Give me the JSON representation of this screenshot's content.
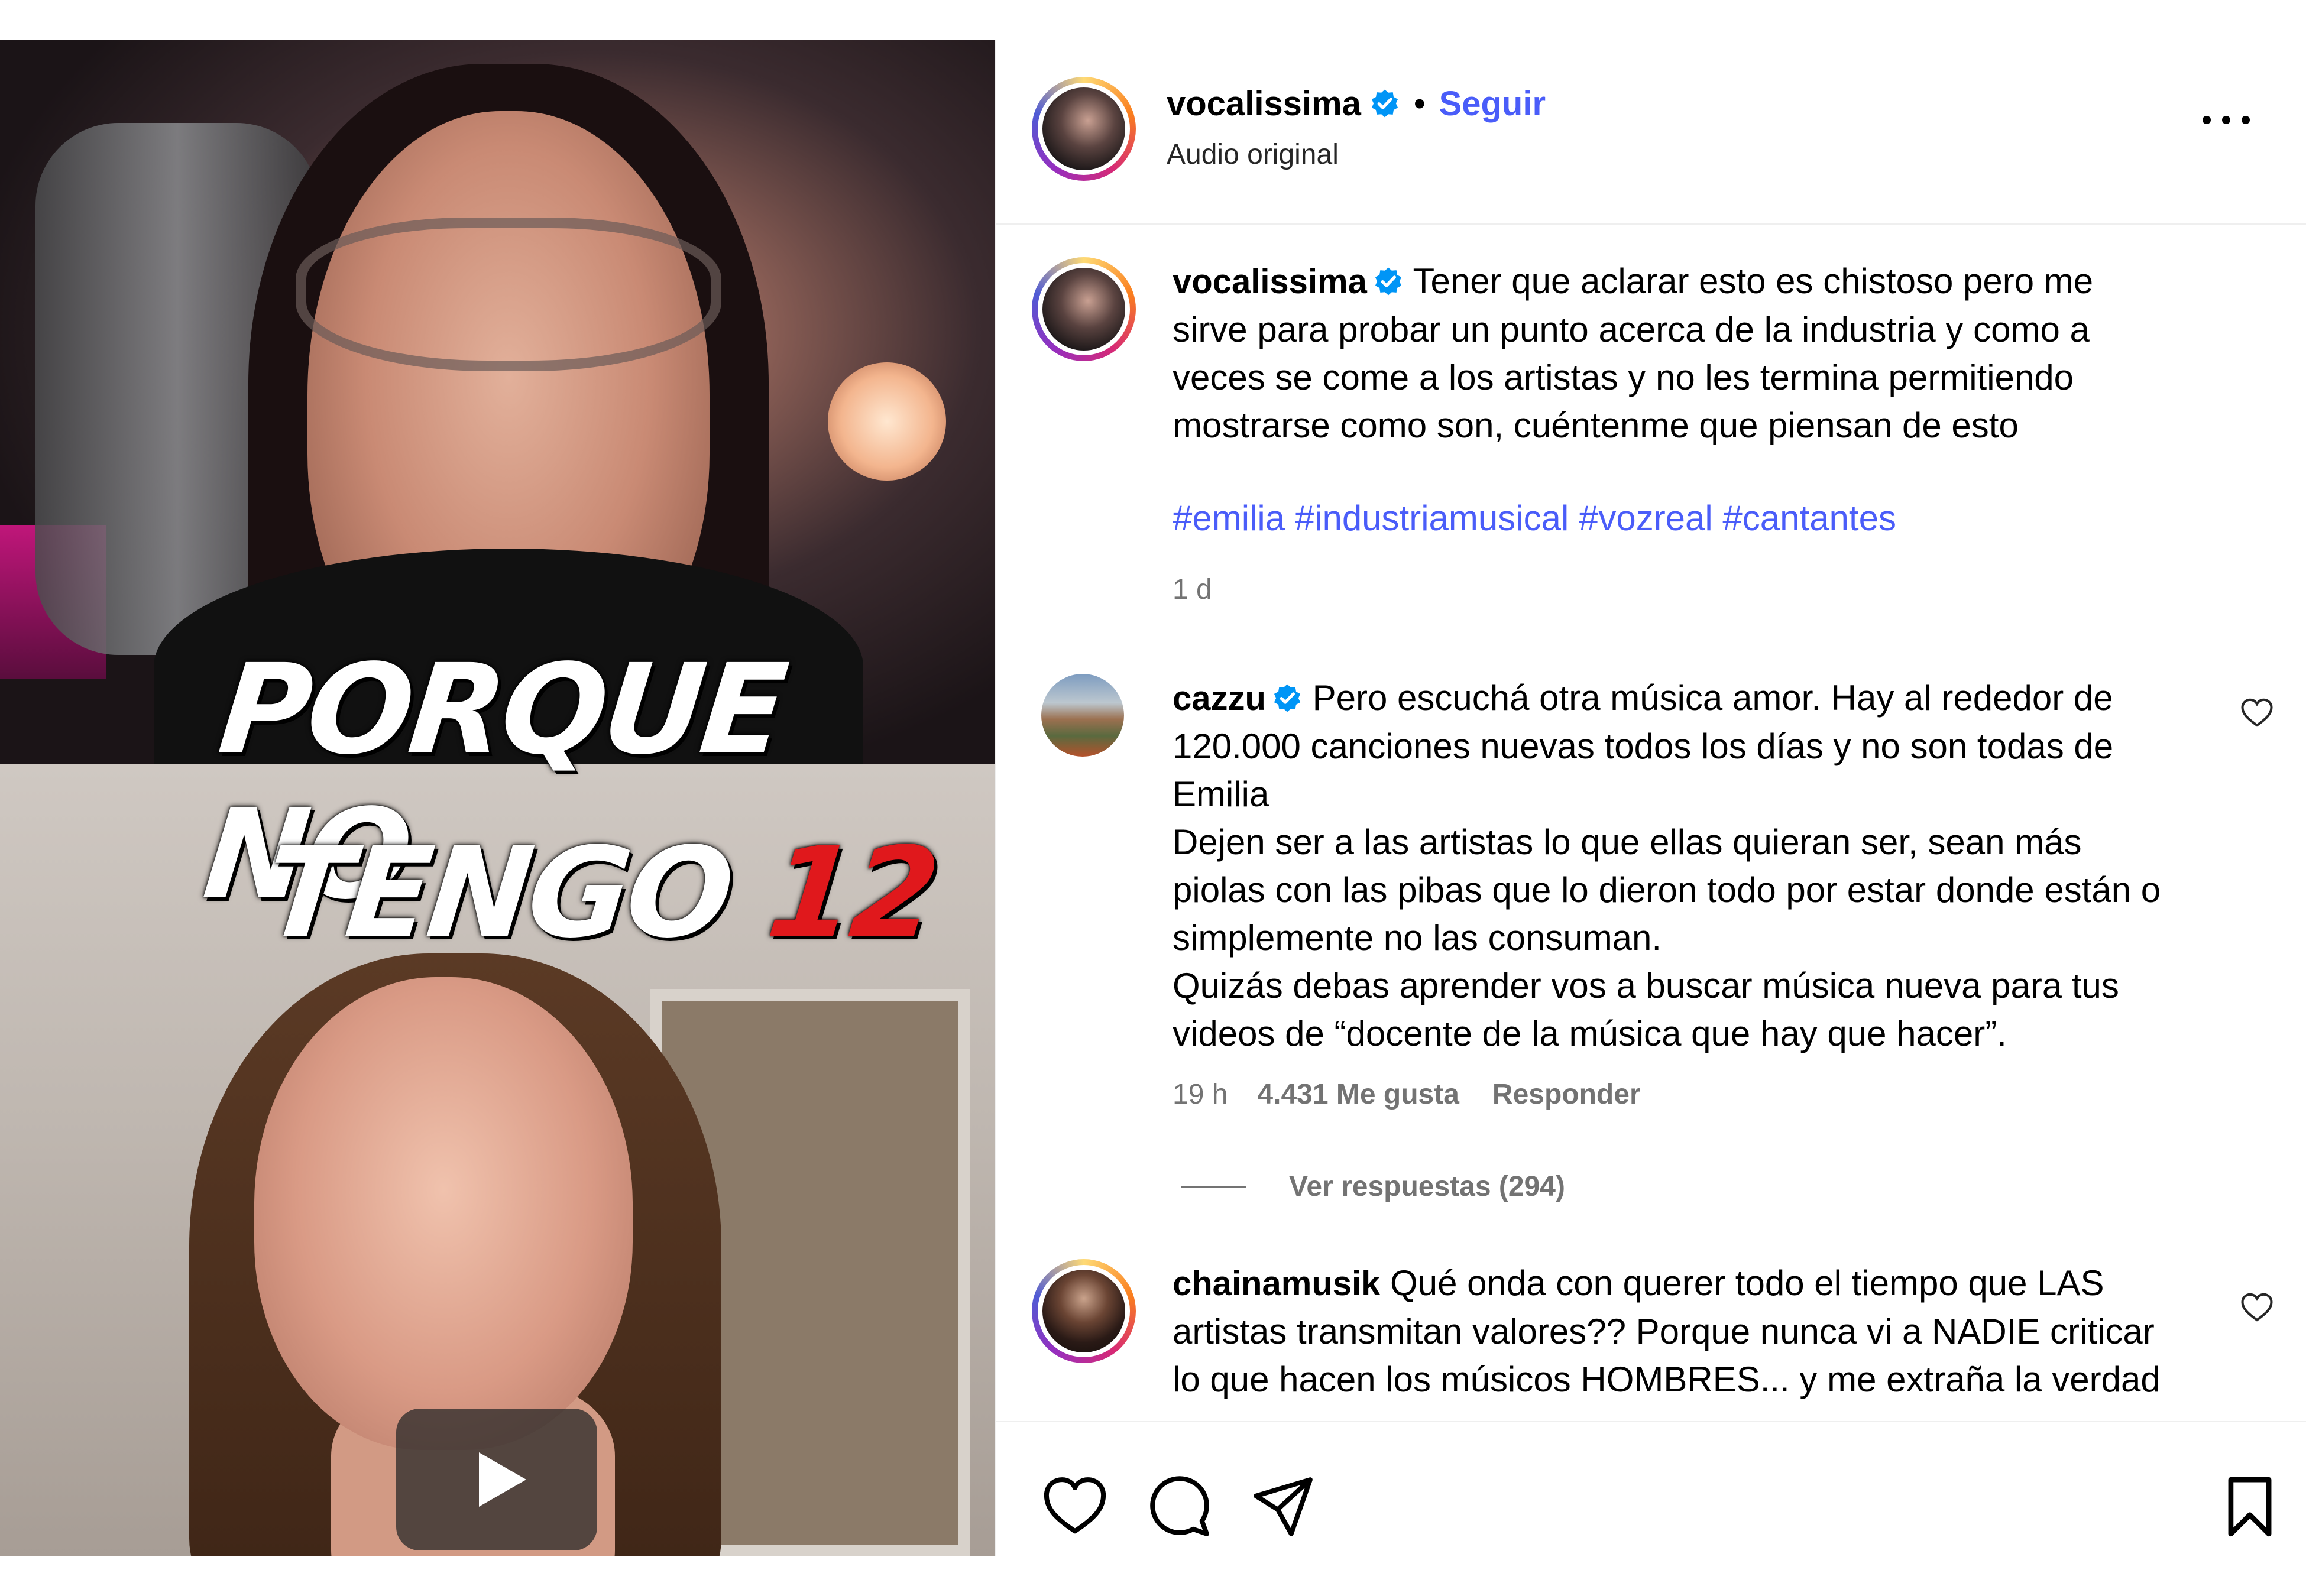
{
  "post": {
    "video": {
      "caption_line1": "PORQUE NO",
      "caption_line2": "TENGO",
      "caption_number": "12"
    },
    "header": {
      "username": "vocalissima",
      "separator": "•",
      "follow_label": "Seguir",
      "audio_label": "Audio original"
    },
    "caption": {
      "username": "vocalissima",
      "text": "Tener que aclarar esto es chistoso pero me sirve para probar un punto acerca de la industria y como a veces se come a los artistas y no les termina permitiendo mostrarse como son, cuéntenme que piensan de esto",
      "hashtags": "#emilia #industriamusical #vozreal #cantantes",
      "time": "1 d"
    },
    "comments": [
      {
        "username": "cazzu",
        "verified": true,
        "text": "Pero escuchá otra música amor. Hay al rededor de 120.000 canciones nuevas todos los días y no son todas de Emilia\nDejen ser a las artistas lo que ellas quieran ser, sean más piolas con las pibas que lo dieron todo por estar donde están o simplemente no las consuman.\nQuizás debas aprender vos a buscar música nueva para tus videos de “docente de la música que hay que hacer”.",
        "time": "19 h",
        "likes": "4.431 Me gusta",
        "reply_label": "Responder",
        "view_replies": "Ver respuestas (294)"
      },
      {
        "username": "chainamusik",
        "verified": false,
        "text": "Qué onda con querer todo el tiempo que LAS artistas transmitan valores?? Porque nunca vi a NADIE criticar lo que hacen los músicos HOMBRES... y me extraña la verdad"
      }
    ]
  },
  "icons": {
    "verified": "verified-badge-icon",
    "more": "more-options-icon",
    "like": "heart-icon",
    "comment": "comment-bubble-icon",
    "share": "paper-plane-icon",
    "save": "bookmark-icon",
    "play": "play-icon"
  },
  "colors": {
    "link_blue": "#4a5df9",
    "verified_blue": "#0095f6",
    "muted_gray": "#737373",
    "caption_red": "#e0181c"
  }
}
